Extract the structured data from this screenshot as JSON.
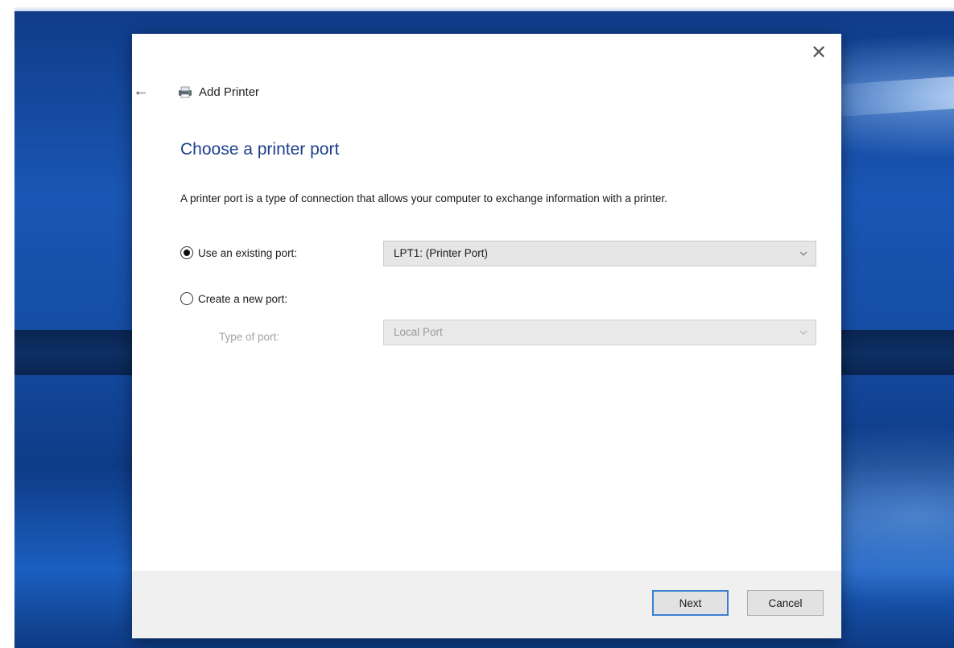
{
  "window": {
    "title": "Add Printer",
    "back_glyph": "←",
    "close_glyph": "✕"
  },
  "main": {
    "heading": "Choose a printer port",
    "description": "A printer port is a type of connection that allows your computer to exchange information with a printer."
  },
  "options": {
    "existing_port": {
      "label": "Use an existing port:",
      "selected": true,
      "value": "LPT1: (Printer Port)"
    },
    "new_port": {
      "label": "Create a new port:",
      "selected": false,
      "type_label": "Type of port:",
      "type_value": "Local Port"
    }
  },
  "footer": {
    "next_label": "Next",
    "cancel_label": "Cancel"
  },
  "icons": {
    "back": "back-arrow-icon",
    "close": "close-icon",
    "printer": "printer-icon",
    "dropdown": "chevron-down-icon"
  },
  "colors": {
    "heading": "#1e3f8c",
    "default_button_border": "#3c7fd0",
    "desktop": "#1a56b4"
  }
}
